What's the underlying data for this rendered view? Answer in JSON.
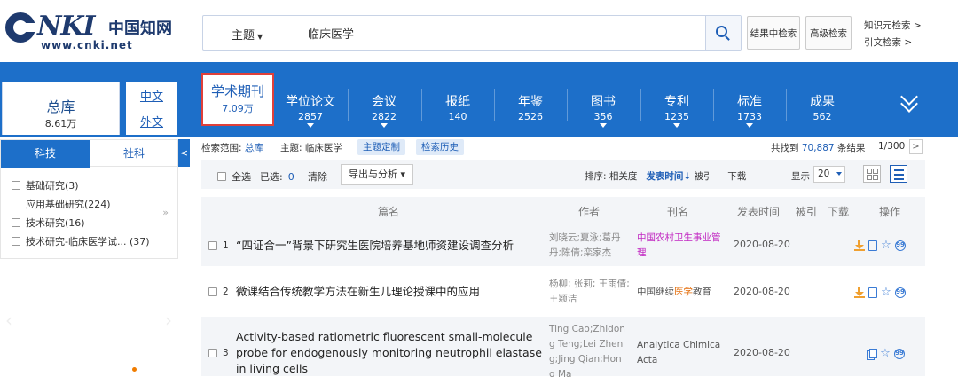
{
  "header": {
    "logo_word": "CNKI",
    "logo_cn": "中国知网",
    "logo_url": "www.cnki.net",
    "search_type": "主题",
    "search_value": "临床医学",
    "btn_in_results": "结果中检索",
    "btn_advanced": "高级检索",
    "link_knowledge": "知识元检索  >",
    "link_citation": "引文检索  >"
  },
  "library": {
    "name": "总库",
    "count": "8.61万",
    "lang_cn": "中文",
    "lang_foreign": "外文"
  },
  "db_tabs": [
    {
      "name": "学术期刊",
      "count": "7.09万",
      "active": true
    },
    {
      "name": "学位论文",
      "count": "2857"
    },
    {
      "name": "会议",
      "count": "2822"
    },
    {
      "name": "报纸",
      "count": "140"
    },
    {
      "name": "年鉴",
      "count": "2526"
    },
    {
      "name": "图书",
      "count": "356"
    },
    {
      "name": "专利",
      "count": "1235"
    },
    {
      "name": "标准",
      "count": "1733"
    },
    {
      "name": "成果",
      "count": "562"
    }
  ],
  "filter": {
    "tab_keji": "科技",
    "tab_sheke": "社科",
    "collapse": "<",
    "expand": "»",
    "items": [
      "基础研究(3)",
      "应用基础研究(224)",
      "技术研究(16)",
      "技术研究-临床医学试... (37)"
    ]
  },
  "scope": {
    "label": "检索范围:",
    "scope_value": "总库",
    "topic": "主题:  临床医学",
    "tag_custom": "主题定制",
    "tag_history": "检索历史",
    "found_prefix": "共找到",
    "found_num": "70,887",
    "found_suffix": "条结果",
    "page": "1/300",
    "page_next": ">"
  },
  "toolbar": {
    "select_all": "全选",
    "selected_label": "已选:",
    "selected_count": "0",
    "clear": "清除",
    "export": "导出与分析 ▾",
    "sort_label": "排序:",
    "sort_relevance": "相关度",
    "sort_date": "发表时间↓",
    "sort_cited": "被引",
    "sort_download": "下载",
    "show_label": "显示",
    "page_size": "20"
  },
  "table": {
    "headers": {
      "title": "篇名",
      "author": "作者",
      "journal": "刊名",
      "date": "发表时间",
      "cited": "被引",
      "downloads": "下载",
      "ops": "操作"
    },
    "rows": [
      {
        "no": "1",
        "title": "“四证合一”背景下研究生医院培养基地师资建设调查分析",
        "author": "刘晓云;夏泳;葛丹丹;陈倩;栾家杰",
        "journal": "中国农村卫生事业管理",
        "date": "2020-08-20"
      },
      {
        "no": "2",
        "title": "微课结合传统教学方法在新生儿理论授课中的应用",
        "author": "杨柳; 张莉; 王雨倩; 王颖洁",
        "journal_pre": "中国继续",
        "journal_hl": "医学",
        "journal_post": "教育",
        "date": "2020-08-20"
      },
      {
        "no": "3",
        "title": "Activity-based ratiometric fluorescent small-molecule probe for endogenously monitoring neutrophil elastase in living cells",
        "author": "Ting Cao;Zhidong Teng;Lei Zheng;Jing Qian;Hong Ma",
        "journal": "Analytica Chimica Acta",
        "date": "2020-08-20"
      }
    ]
  }
}
